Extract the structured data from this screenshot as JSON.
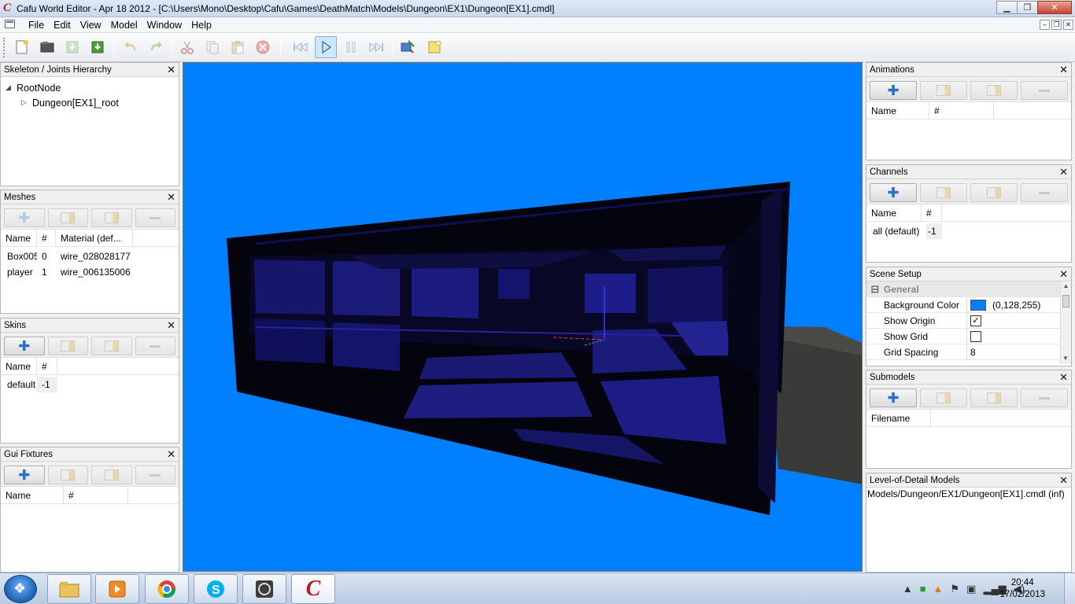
{
  "window": {
    "title": "Cafu World Editor - Apr 18 2012 - [C:\\Users\\Mono\\Desktop\\Cafu\\Games\\DeathMatch\\Models\\Dungeon\\EX1\\Dungeon[EX1].cmdl]",
    "logo": "C"
  },
  "menu": {
    "items": [
      "File",
      "Edit",
      "View",
      "Model",
      "Window",
      "Help"
    ]
  },
  "skeleton": {
    "title": "Skeleton / Joints Hierarchy",
    "root": "RootNode",
    "child": "Dungeon[EX1]_root"
  },
  "meshes": {
    "title": "Meshes",
    "columns": [
      "Name",
      "#",
      "Material (def..."
    ],
    "rows": [
      [
        "Box005",
        "0",
        "wire_028028177"
      ],
      [
        "player",
        "1",
        "wire_006135006"
      ]
    ]
  },
  "skins": {
    "title": "Skins",
    "columns": [
      "Name",
      "#"
    ],
    "rows": [
      [
        "default",
        "-1"
      ]
    ]
  },
  "gui_fixtures": {
    "title": "Gui Fixtures",
    "columns": [
      "Name",
      "#"
    ]
  },
  "animations": {
    "title": "Animations",
    "columns": [
      "Name",
      "#"
    ]
  },
  "channels": {
    "title": "Channels",
    "columns": [
      "Name",
      "#"
    ],
    "rows": [
      [
        "all (default)",
        "-1"
      ]
    ]
  },
  "scene_setup": {
    "title": "Scene Setup",
    "category": "General",
    "props": {
      "bg_color_label": "Background Color",
      "bg_color_value": "(0,128,255)",
      "bg_color_hex": "#0080ff",
      "show_origin_label": "Show Origin",
      "show_origin_checked": true,
      "show_grid_label": "Show Grid",
      "show_grid_checked": false,
      "grid_spacing_label": "Grid Spacing",
      "grid_spacing_value": "8"
    },
    "collapse_glyph": "⊟"
  },
  "submodels": {
    "title": "Submodels",
    "columns": [
      "Filename"
    ]
  },
  "lod": {
    "title": "Level-of-Detail Models",
    "path": "Models/Dungeon/EX1/Dungeon[EX1].cmdl (inf)"
  },
  "clock": {
    "time": "20:44",
    "date": "17/02/2013"
  },
  "glyphs": {
    "close": "✕",
    "plus": "✚",
    "check": "✓",
    "tri_open": "◢",
    "tri_closed": "▷"
  }
}
